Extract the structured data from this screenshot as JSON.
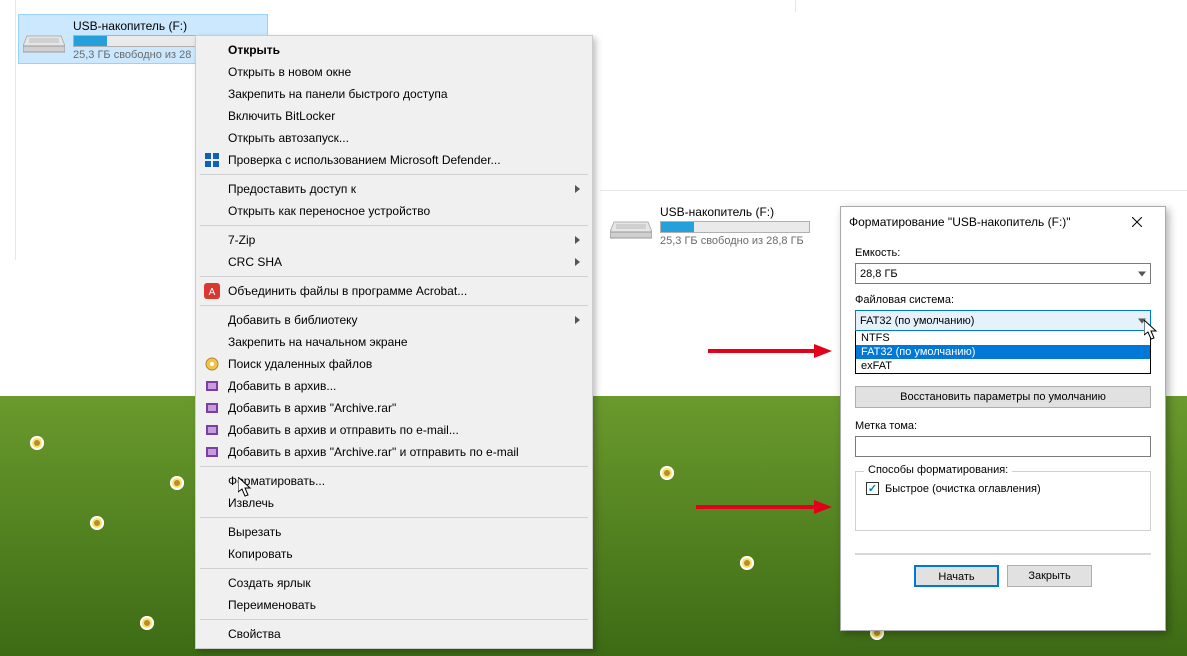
{
  "drive1": {
    "label": "USB-накопитель (F:)",
    "free_text": "25,3 ГБ свободно из 28",
    "fill_percent": 22
  },
  "drive2": {
    "label": "USB-накопитель (F:)",
    "free_text": "25,3 ГБ свободно из 28,8 ГБ",
    "fill_percent": 22
  },
  "context_menu": {
    "open": "Открыть",
    "open_new_window": "Открыть в новом окне",
    "pin_quick_access": "Закрепить на панели быстрого доступа",
    "enable_bitlocker": "Включить BitLocker",
    "open_autoplay": "Открыть автозапуск...",
    "defender_scan": "Проверка с использованием Microsoft Defender...",
    "give_access": "Предоставить доступ к",
    "open_portable": "Открыть как переносное устройство",
    "seven_zip": "7-Zip",
    "crc_sha": "CRC SHA",
    "combine_acrobat": "Объединить файлы в программе Acrobat...",
    "add_library": "Добавить в библиотеку",
    "pin_start": "Закрепить на начальном экране",
    "recuva": "Поиск удаленных файлов",
    "add_archive": "Добавить в архив...",
    "add_archive_rar": "Добавить в архив \"Archive.rar\"",
    "add_archive_email": "Добавить в архив и отправить по e-mail...",
    "add_archive_rar_email": "Добавить в архив \"Archive.rar\" и отправить по e-mail",
    "format": "Форматировать...",
    "eject": "Извлечь",
    "cut": "Вырезать",
    "copy": "Копировать",
    "shortcut": "Создать ярлык",
    "rename": "Переименовать",
    "properties": "Свойства"
  },
  "dialog": {
    "title": "Форматирование \"USB-накопитель (F:)\"",
    "capacity_label": "Емкость:",
    "capacity_value": "28,8 ГБ",
    "fs_label": "Файловая система:",
    "fs_value": "FAT32 (по умолчанию)",
    "fs_options": {
      "ntfs": "NTFS",
      "fat32": "FAT32 (по умолчанию)",
      "exfat": "exFAT"
    },
    "restore_defaults": "Восстановить параметры по умолчанию",
    "volume_label": "Метка тома:",
    "volume_value": "",
    "methods_label": "Способы форматирования:",
    "quick_format": "Быстрое (очистка оглавления)",
    "start": "Начать",
    "close": "Закрыть"
  }
}
